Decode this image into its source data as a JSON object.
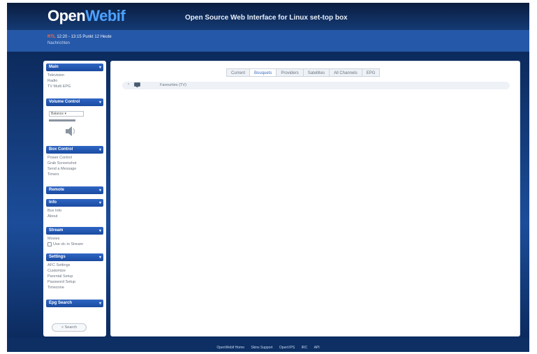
{
  "header": {
    "logo_part1": "Open",
    "logo_part2": "Webif",
    "tagline": "Open Source Web Interface for Linux set-top box"
  },
  "now_playing": {
    "channel": "RTL",
    "time_title": "12:20 - 13:15 Punkt 12 Heute",
    "subtitle": "Nachrichten"
  },
  "sidebar": {
    "main": {
      "title": "Main",
      "items": [
        "Television",
        "Radio",
        "TV Multi EPG"
      ]
    },
    "volume": {
      "title": "Volume Control",
      "select_value": "Balance"
    },
    "box_control": {
      "title": "Box Control",
      "items": [
        "Power Control",
        "Grab Screenshot",
        "Send a Message",
        "Timers"
      ]
    },
    "remote": {
      "title": "Remote"
    },
    "info": {
      "title": "Info",
      "items": [
        "Box Info",
        "About"
      ]
    },
    "stream": {
      "title": "Stream",
      "items": [
        "Movies"
      ],
      "checkbox_label": "Use vlc in Stream"
    },
    "settings": {
      "title": "Settings",
      "items": [
        "AFC Settings",
        "Customize",
        "Parental Setup",
        "Password Setup",
        "Timezone"
      ]
    },
    "epg_search": {
      "title": "Epg Search",
      "button_label": "Search"
    }
  },
  "main": {
    "tabs": [
      "Current",
      "Bouquets",
      "Providers",
      "Satellites",
      "All Channels",
      "EPG"
    ],
    "active_tab": "Bouquets",
    "bouquets": [
      {
        "label": "Favourites (TV)"
      }
    ]
  },
  "footer": {
    "links": [
      "OpenWebif Home",
      "Skins Support",
      "OpenVPS",
      "IRC",
      "API"
    ]
  }
}
